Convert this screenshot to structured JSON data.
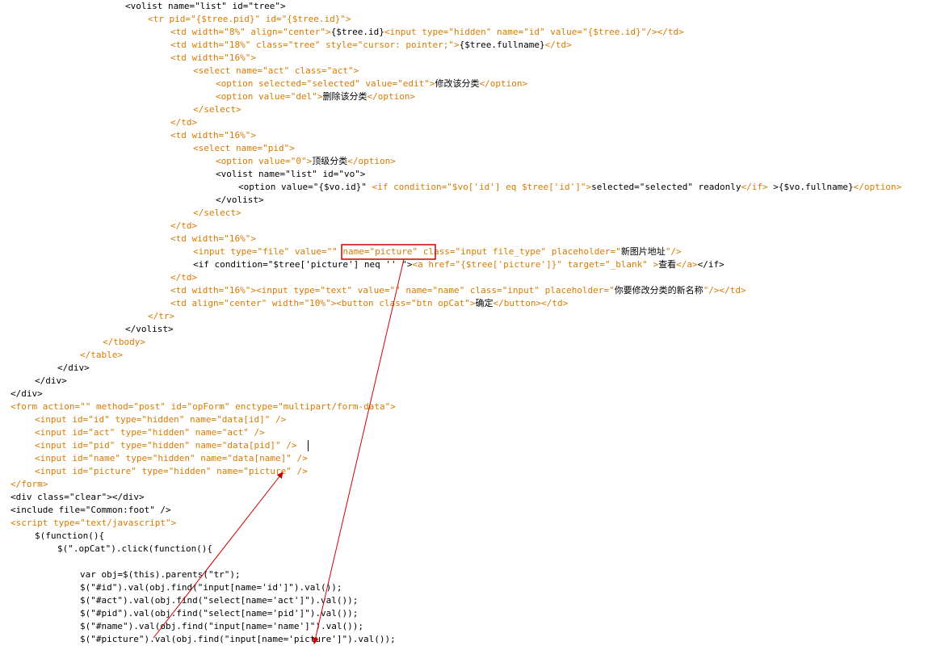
{
  "colors": {
    "tag": "#d97a00",
    "text": "#000000",
    "annotation": "#cc0000"
  },
  "code_lines": [
    [
      [
        "t",
        "<volist name=\"list\" id=\"tree\">"
      ]
    ],
    [
      [
        "c",
        "<tr pid=\"{$tree.pid}\" id=\"{$tree.id}\">"
      ]
    ],
    [
      [
        "c",
        "<td width=\"8%\" align=\"center\">"
      ],
      [
        "t",
        "{$tree.id}"
      ],
      [
        "c",
        "<input type=\"hidden\" name=\"id\" value=\"{$tree.id}\"/></td>"
      ]
    ],
    [
      [
        "c",
        "<td width=\"18%\" class=\"tree\" style=\"cursor: pointer;\">"
      ],
      [
        "t",
        "{$tree.fullname}"
      ],
      [
        "c",
        "</td>"
      ]
    ],
    [
      [
        "c",
        "<td width=\"16%\">"
      ]
    ],
    [
      [
        "c",
        "<select name=\"act\" class=\"act\">"
      ]
    ],
    [
      [
        "c",
        "<option selected=\"selected\" value=\"edit\">"
      ],
      [
        "z",
        "修改该分类"
      ],
      [
        "c",
        "</option>"
      ]
    ],
    [
      [
        "c",
        "<option value=\"del\">"
      ],
      [
        "z",
        "删除该分类"
      ],
      [
        "c",
        "</option>"
      ]
    ],
    [
      [
        "c",
        "</select>"
      ]
    ],
    [
      [
        "c",
        "</td>"
      ]
    ],
    [
      [
        "c",
        "<td width=\"16%\">"
      ]
    ],
    [
      [
        "c",
        "<select name=\"pid\">"
      ]
    ],
    [
      [
        "c",
        "<option value=\"0\">"
      ],
      [
        "z",
        "顶级分类"
      ],
      [
        "c",
        "</option>"
      ]
    ],
    [
      [
        "t",
        "<volist name=\"list\" id=\"vo\">"
      ]
    ],
    [
      [
        "t",
        "<option value=\"{$vo.id}\" "
      ],
      [
        "c",
        "<if condition=\"$vo['id'] eq $tree['id']\">"
      ],
      [
        "t",
        "selected=\"selected\" readonly"
      ],
      [
        "c",
        "</if>"
      ],
      [
        "t",
        " >{$vo.fullname}"
      ],
      [
        "c",
        "</option>"
      ]
    ],
    [
      [
        "t",
        "</volist>"
      ]
    ],
    [
      [
        "c",
        "</select>"
      ]
    ],
    [
      [
        "c",
        "</td>"
      ]
    ],
    [
      [
        "c",
        "<td width=\"16%\">"
      ]
    ],
    [
      [
        "c",
        "<input type=\"file\" value=\"\" name=\"picture\" class=\"input file_type\" placeholder=\""
      ],
      [
        "z",
        "新图片地址"
      ],
      [
        "c",
        "\"/>"
      ]
    ],
    [
      [
        "t",
        "<if condition=\"$tree['picture'] neq '' \">"
      ],
      [
        "c",
        "<a href=\"{$tree['picture']}\" target=\"_blank\" >"
      ],
      [
        "z",
        "查看"
      ],
      [
        "c",
        "</a>"
      ],
      [
        "t",
        "</if>"
      ]
    ],
    [
      [
        "c",
        "</td>"
      ]
    ],
    [
      [
        "c",
        "<td width=\"16%\"><input type=\"text\" value=\"\" name=\"name\" class=\"input\" placeholder=\""
      ],
      [
        "z",
        "你要修改分类的新名称"
      ],
      [
        "c",
        "\"/></td>"
      ]
    ],
    [
      [
        "c",
        "<td align=\"center\" width=\"10%\"><button class=\"btn opCat\">"
      ],
      [
        "z",
        "确定"
      ],
      [
        "c",
        "</button></td>"
      ]
    ],
    [
      [
        "c",
        "</tr>"
      ]
    ],
    [
      [
        "t",
        "</volist>"
      ]
    ],
    [
      [
        "c",
        "</tbody>"
      ]
    ],
    [
      [
        "c",
        "</table>"
      ]
    ],
    [
      [
        "t",
        "</div>"
      ]
    ],
    [
      [
        "t",
        "</div>"
      ]
    ],
    [
      [
        "t",
        "</div>"
      ]
    ],
    [
      [
        "c",
        "<form action=\"\" method=\"post\" id=\"opForm\" enctype=\"multipart/form-data\">"
      ]
    ],
    [
      [
        "c",
        "<input id=\"id\" type=\"hidden\" name=\"data[id]\" />"
      ]
    ],
    [
      [
        "c",
        "<input id=\"act\" type=\"hidden\" name=\"act\" />"
      ]
    ],
    [
      [
        "c",
        "<input id=\"pid\" type=\"hidden\" name=\"data[pid]\" />"
      ]
    ],
    [
      [
        "c",
        "<input id=\"name\" type=\"hidden\" name=\"data[name]\" />"
      ]
    ],
    [
      [
        "c",
        "<input id=\"picture\" type=\"hidden\" name=\"picture\" />"
      ]
    ],
    [
      [
        "c",
        "</form>"
      ]
    ],
    [
      [
        "t",
        "<div class=\"clear\"></div>"
      ]
    ],
    [
      [
        "t",
        "<include file=\"Common:foot\" />"
      ]
    ],
    [
      [
        "c",
        "<script type=\"text/javascript\">"
      ]
    ],
    [
      [
        "t",
        "$(function(){"
      ]
    ],
    [
      [
        "t",
        "$(\".opCat\").click(function(){"
      ]
    ],
    [
      [
        "t",
        ""
      ]
    ],
    [
      [
        "t",
        "var obj=$(this).parents(\"tr\");"
      ]
    ],
    [
      [
        "t",
        "$(\"#id\").val(obj.find(\"input[name='id']\").val());"
      ]
    ],
    [
      [
        "t",
        "$(\"#act\").val(obj.find(\"select[name='act']\").val());"
      ]
    ],
    [
      [
        "t",
        "$(\"#pid\").val(obj.find(\"select[name='pid']\").val());"
      ]
    ],
    [
      [
        "t",
        "$(\"#name\").val(obj.find(\"input[name='name']\").val());"
      ]
    ],
    [
      [
        "t",
        "$(\"#picture\").val(obj.find(\"input[name='picture']\").val());"
      ]
    ]
  ]
}
